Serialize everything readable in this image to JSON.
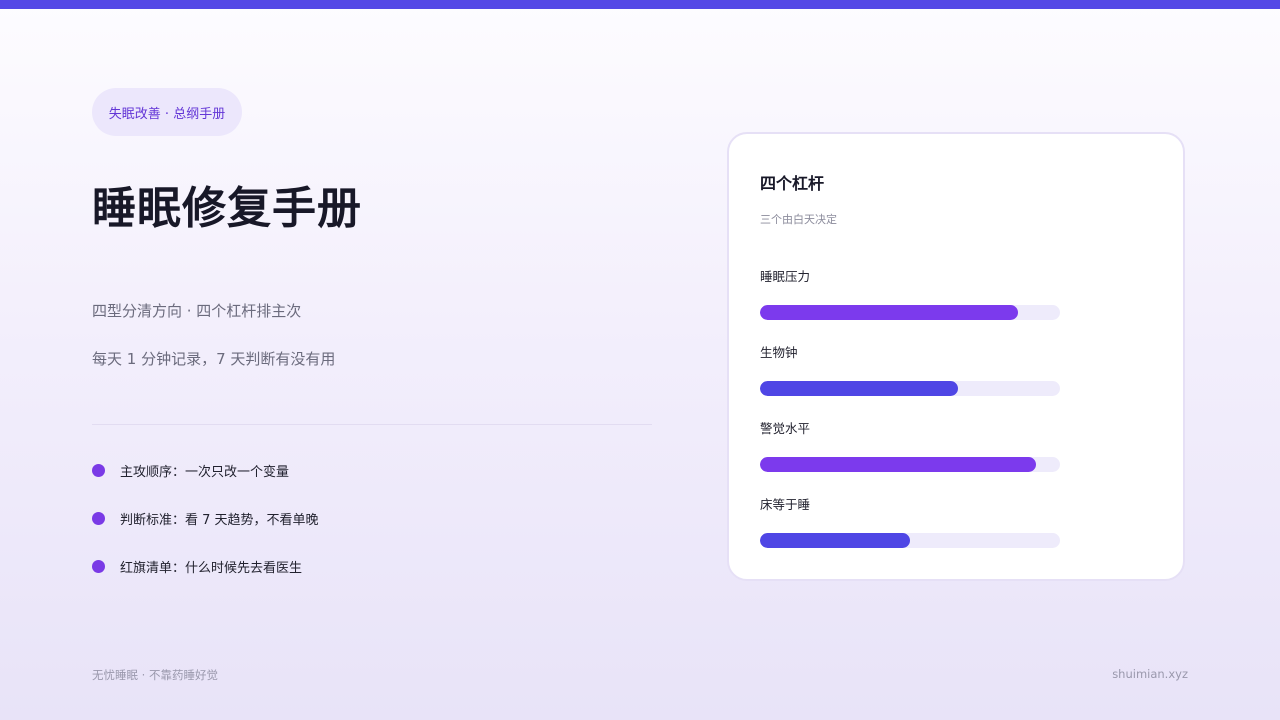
{
  "header": {
    "tag": "失眠改善 · 总纲手册",
    "title": "睡眠修复手册",
    "subtitles": [
      "四型分清方向 · 四个杠杆排主次",
      "每天 1 分钟记录，7 天判断有没有用"
    ]
  },
  "bullets": [
    "主攻顺序：一次只改一个变量",
    "判断标准：看 7 天趋势，不看单晚",
    "红旗清单：什么时候先去看医生"
  ],
  "card": {
    "title": "四个杠杆",
    "subtitle": "三个由白天决定",
    "levers": [
      {
        "label": "睡眠压力",
        "level": 0.86,
        "color": "#7c3aed"
      },
      {
        "label": "生物钟",
        "level": 0.66,
        "color": "#4f46e5"
      },
      {
        "label": "警觉水平",
        "level": 0.92,
        "color": "#7c3aed"
      },
      {
        "label": "床等于睡",
        "level": 0.5,
        "color": "#4f46e5"
      }
    ]
  },
  "footer": {
    "left": "无忧睡眠 · 不靠药睡好觉",
    "right": "shuimian.xyz"
  },
  "colors": {
    "accent": "#5548e6",
    "bullet_dot": "#7a3ae6",
    "tag_text": "#6336d6",
    "tag_bg": "#ece7fc"
  }
}
